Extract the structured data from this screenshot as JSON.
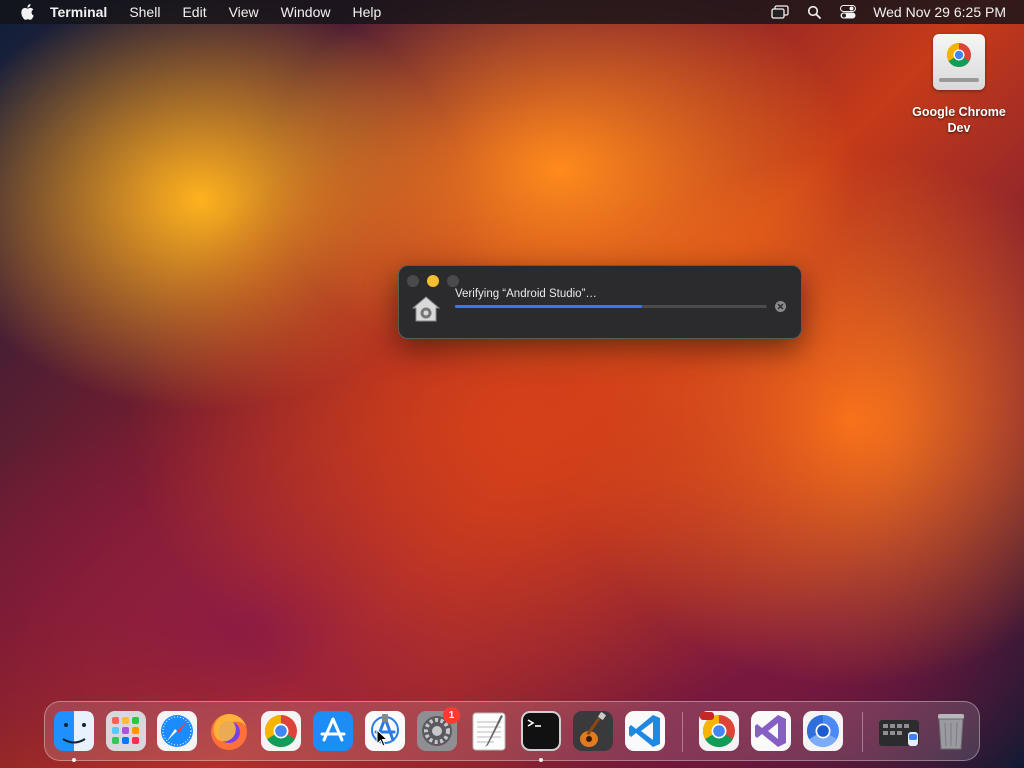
{
  "menubar": {
    "apple_icon": "apple-logo-icon",
    "app_name": "Terminal",
    "menus": [
      "Shell",
      "Edit",
      "View",
      "Window",
      "Help"
    ],
    "status_icons": [
      "screen-mirroring-icon",
      "search-icon",
      "control-center-icon"
    ],
    "clock": "Wed Nov 29  6:25 PM"
  },
  "desktop": {
    "icons": [
      {
        "label": "Google Chrome Dev",
        "icon": "chrome-dev-drive-icon"
      }
    ]
  },
  "dialog": {
    "title": "Verifying “Android Studio”…",
    "progress_percent": 60,
    "icon": "gatekeeper-house-icon",
    "cancel_icon": "cancel-x-icon"
  },
  "dock": {
    "items": [
      {
        "name": "Finder",
        "icon": "finder-icon",
        "running": true
      },
      {
        "name": "Launchpad",
        "icon": "launchpad-icon",
        "running": false
      },
      {
        "name": "Safari",
        "icon": "safari-icon",
        "running": false
      },
      {
        "name": "Firefox",
        "icon": "firefox-icon",
        "running": false
      },
      {
        "name": "Google Chrome",
        "icon": "chrome-icon",
        "running": false
      },
      {
        "name": "App Store",
        "icon": "app-store-icon",
        "running": false
      },
      {
        "name": "Xcode",
        "icon": "xcode-icon",
        "running": false
      },
      {
        "name": "System Settings",
        "icon": "system-settings-icon",
        "running": false,
        "badge": "1"
      },
      {
        "name": "TextEdit",
        "icon": "textedit-icon",
        "running": false
      },
      {
        "name": "Terminal",
        "icon": "terminal-icon",
        "running": true
      },
      {
        "name": "GarageBand",
        "icon": "garageband-icon",
        "running": false
      },
      {
        "name": "Visual Studio Code",
        "icon": "vscode-icon",
        "running": false
      },
      {
        "name": "Google Chrome Dev",
        "icon": "chrome-dev-icon",
        "running": false
      },
      {
        "name": "Visual Studio",
        "icon": "visual-studio-icon",
        "running": false
      },
      {
        "name": "Chromium",
        "icon": "chromium-icon",
        "running": false
      },
      {
        "name": "Downloads",
        "icon": "downloads-stack-icon",
        "running": false
      },
      {
        "name": "Trash",
        "icon": "trash-icon",
        "running": false
      }
    ]
  },
  "colors": {
    "accent_blue": "#2f7bf5",
    "minimize_yellow": "#f4bf2e",
    "badge_red": "#ff3b30"
  }
}
